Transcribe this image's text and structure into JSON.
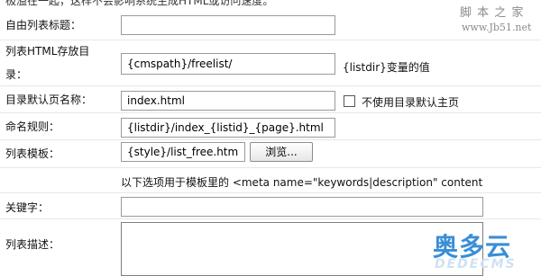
{
  "top_hint": "极溢在一起，这样不会影响系统生成HTML或访问速度。",
  "watermark": {
    "site_name": "脚 本 之 家",
    "site_url": "www.Jb51.net",
    "logo_cn": "奥多云",
    "logo_en": "DEDECMS"
  },
  "form": {
    "custom_title": {
      "label": "自由列表标题：",
      "value": ""
    },
    "html_dir": {
      "label_line1": "列表HTML存放目",
      "label_line2": "录：",
      "value": "{cmspath}/freelist/",
      "note": "{listdir}变量的值"
    },
    "default_page": {
      "label": "目录默认页名称：",
      "value": "index.html",
      "checkbox_label": "不使用目录默认主页",
      "checked": false
    },
    "naming_rule": {
      "label": "命名规则：",
      "value": "{listdir}/index_{listid}_{page}.html"
    },
    "template": {
      "label": "列表模板：",
      "value": "{style}/list_free.htm",
      "browse_label": "浏览..."
    },
    "meta_note": "以下选项用于模板里的 <meta name=\"keywords|description\" content",
    "keywords": {
      "label": "关键字：",
      "value": ""
    },
    "description": {
      "label": "列表描述：",
      "value": ""
    }
  }
}
